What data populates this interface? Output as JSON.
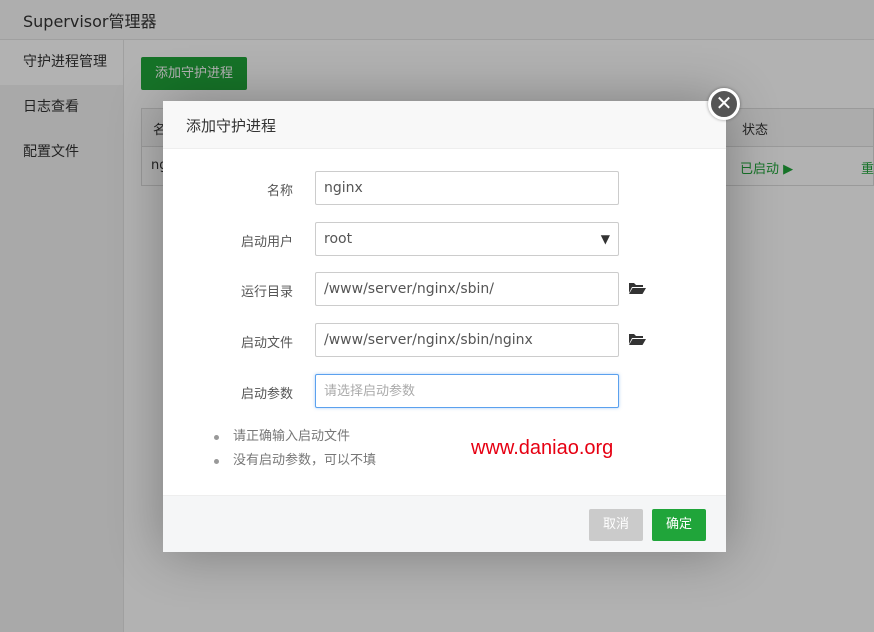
{
  "app": {
    "title": "Supervisor管理器"
  },
  "sidebar": {
    "items": [
      {
        "label": "守护进程管理",
        "active": true
      },
      {
        "label": "日志查看",
        "active": false
      },
      {
        "label": "配置文件",
        "active": false
      }
    ]
  },
  "toolbar": {
    "add_label": "添加守护进程"
  },
  "table": {
    "headers": {
      "name": "名",
      "status": "状态"
    },
    "row": {
      "name": "ng",
      "status": "已启动 ▶",
      "action": "重"
    }
  },
  "dialog": {
    "title": "添加守护进程",
    "close_glyph": "✕",
    "fields": {
      "name": {
        "label": "名称",
        "value": "nginx"
      },
      "user": {
        "label": "启动用户",
        "value": "root"
      },
      "dir": {
        "label": "运行目录",
        "value": "/www/server/nginx/sbin/"
      },
      "file": {
        "label": "启动文件",
        "value": "/www/server/nginx/sbin/nginx"
      },
      "params": {
        "label": "启动参数",
        "value": "",
        "placeholder": "请选择启动参数"
      }
    },
    "select_arrow": "▼",
    "tips": [
      "请正确输入启动文件",
      "没有启动参数，可以不填"
    ],
    "watermark": "www.daniao.org",
    "buttons": {
      "cancel": "取消",
      "ok": "确定"
    }
  },
  "colors": {
    "accent": "#20a53a",
    "watermark": "#e60012",
    "focus_border": "#5ba1ee"
  },
  "icons": {
    "folder": "folder-open-icon",
    "close": "close-icon"
  }
}
